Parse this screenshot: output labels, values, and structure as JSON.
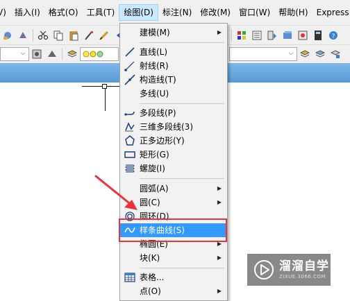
{
  "menubar": {
    "items": [
      {
        "label": "V)"
      },
      {
        "label": "插入(I)"
      },
      {
        "label": "格式(O)"
      },
      {
        "label": "工具(T)"
      },
      {
        "label": "绘图(D)",
        "active": true
      },
      {
        "label": "标注(N)"
      },
      {
        "label": "修改(M)"
      },
      {
        "label": "窗口(W)"
      },
      {
        "label": "帮助(H)"
      },
      {
        "label": "Express"
      }
    ]
  },
  "draw_menu": {
    "items": [
      {
        "label": "建模(M)",
        "icon": "none",
        "submenu": true
      },
      {
        "label": "直线(L)",
        "icon": "line-icon"
      },
      {
        "label": "射线(R)",
        "icon": "ray-icon"
      },
      {
        "label": "构造线(T)",
        "icon": "construction-line-icon"
      },
      {
        "label": "多线(U)",
        "icon": "none"
      },
      {
        "label": "多段线(P)",
        "icon": "polyline-icon"
      },
      {
        "label": "三维多段线(3)",
        "icon": "3d-polyline-icon"
      },
      {
        "label": "正多边形(Y)",
        "icon": "polygon-icon"
      },
      {
        "label": "矩形(G)",
        "icon": "rectangle-icon"
      },
      {
        "label": "螺旋(I)",
        "icon": "helix-icon"
      },
      {
        "label": "圆弧(A)",
        "icon": "none",
        "submenu": true
      },
      {
        "label": "圆(C)",
        "icon": "none",
        "submenu": true
      },
      {
        "label": "圆环(D)",
        "icon": "donut-icon"
      },
      {
        "label": "样条曲线(S)",
        "icon": "spline-icon",
        "highlighted": true
      },
      {
        "label": "椭圆(E)",
        "icon": "none",
        "submenu": true
      },
      {
        "label": "块(K)",
        "icon": "none",
        "submenu": true
      },
      {
        "label": "表格...",
        "icon": "table-icon"
      },
      {
        "label": "点(O)",
        "icon": "none",
        "submenu": true
      }
    ]
  },
  "watermark": {
    "title": "溜溜自学",
    "url": "ZIXUE.3066.COM"
  },
  "colors": {
    "highlight": "#3399ff",
    "annotation_red": "#e8333a",
    "menu_bg": "#f2f2f2"
  }
}
